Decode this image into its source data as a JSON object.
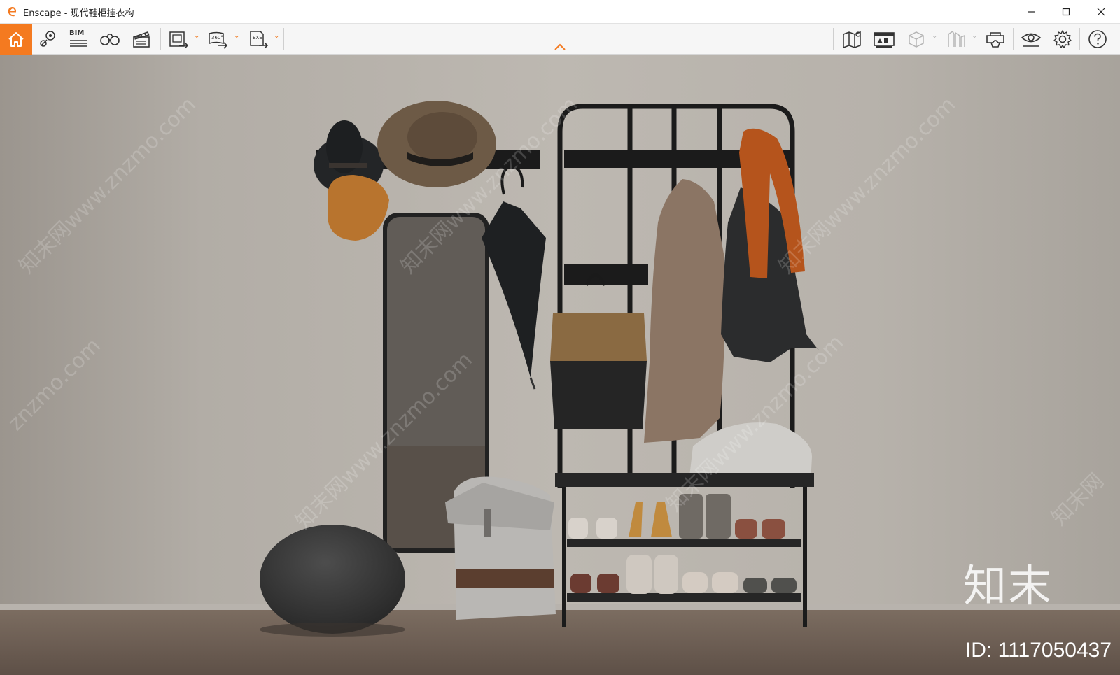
{
  "window": {
    "title": "Enscape - 现代鞋柜挂衣构",
    "controls": {
      "minimize": "minimize",
      "maximize": "maximize",
      "close": "close"
    }
  },
  "toolbar": {
    "accent_color": "#f47a20",
    "left_tools": [
      {
        "name": "home",
        "icon": "home-icon"
      },
      {
        "name": "views",
        "icon": "map-pin-icon"
      },
      {
        "name": "bim",
        "label": "BIM",
        "icon": "bim-icon"
      },
      {
        "name": "binoculars",
        "icon": "binoculars-icon"
      },
      {
        "name": "video",
        "icon": "clapperboard-icon"
      },
      {
        "name": "render-image",
        "icon": "export-image-icon"
      },
      {
        "name": "render-panorama",
        "label": "360°",
        "icon": "export-panorama-icon"
      },
      {
        "name": "export-exe",
        "label": "EXE",
        "icon": "export-exe-icon"
      }
    ],
    "collapse_icon": "chevron-up-icon",
    "right_tools": [
      {
        "name": "map",
        "icon": "map-icon"
      },
      {
        "name": "asset-library",
        "icon": "asset-library-icon"
      },
      {
        "name": "cube",
        "icon": "cube-icon"
      },
      {
        "name": "site-context",
        "icon": "site-context-icon"
      },
      {
        "name": "vr-headset",
        "icon": "vr-headset-icon"
      },
      {
        "name": "visual-settings",
        "icon": "eye-icon"
      },
      {
        "name": "general-settings",
        "icon": "gear-icon"
      },
      {
        "name": "help",
        "icon": "help-icon"
      }
    ]
  },
  "viewport": {
    "watermarks": [
      "知末网www.znzmo.com",
      "znzmo.com",
      "知末网www.znzmo.com",
      "知末网www.znzmo.com",
      "知末网www.znzmo.com",
      "知末网www.znzmo.com",
      "知末网"
    ],
    "brand_text": "知末",
    "id_text": "ID: 1117050437"
  }
}
